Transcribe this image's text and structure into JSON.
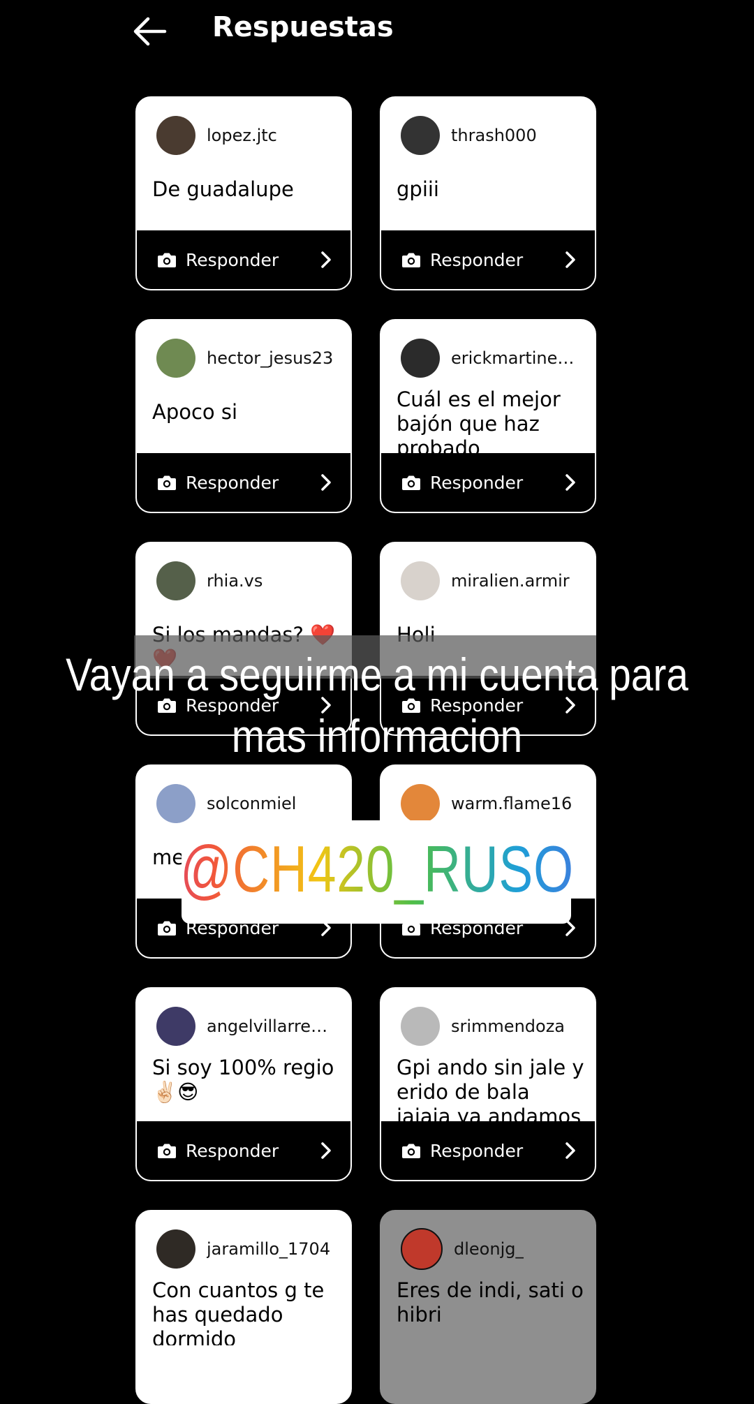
{
  "header": {
    "title": "Respuestas"
  },
  "reply_label": "Responder",
  "cards": [
    {
      "username": "lopez.jtc",
      "text": "De guadalupe",
      "avatar_color": "#4a3b30"
    },
    {
      "username": "thrash000",
      "text": "gpiii",
      "avatar_color": "#333333"
    },
    {
      "username": "hector_jesus23",
      "text": "Apoco si",
      "avatar_color": "#6f8a52"
    },
    {
      "username": "erickmartinez…",
      "text": "Cuál es el mejor bajón que haz probado",
      "avatar_color": "#2b2b2b"
    },
    {
      "username": "rhia.vs",
      "text": "Si los mandas? ❤️❤️",
      "avatar_color": "#55604a"
    },
    {
      "username": "miralien.armir",
      "text": "Holi",
      "avatar_color": "#d8d2cc"
    },
    {
      "username": "solconmiel",
      "text": "me",
      "avatar_color": "#8c9fc8"
    },
    {
      "username": "warm.flame16",
      "text": "",
      "avatar_color": "#e3873a"
    },
    {
      "username": "angelvillarrea…",
      "text": "Si soy 100% regio ✌🏻😎",
      "avatar_color": "#3e3a66"
    },
    {
      "username": "srimmendoza",
      "text": "Gpi ando sin jale y erido de bala jajaja ya andamos en busca de un jale nuevo ja",
      "avatar_color": "#b9b9b9"
    },
    {
      "username": "jaramillo_1704",
      "text": "Con cuantos g te has quedado dormido",
      "avatar_color": "#2f2a25"
    },
    {
      "username": "dleonjg_",
      "text": "Eres de indi, sati o hibri",
      "avatar_color": "#c0392b"
    }
  ],
  "overlay": {
    "line1": "Vayan a seguirme a mi cuenta para",
    "line2": "mas informacion",
    "handle": "@CH420_RUSO"
  }
}
